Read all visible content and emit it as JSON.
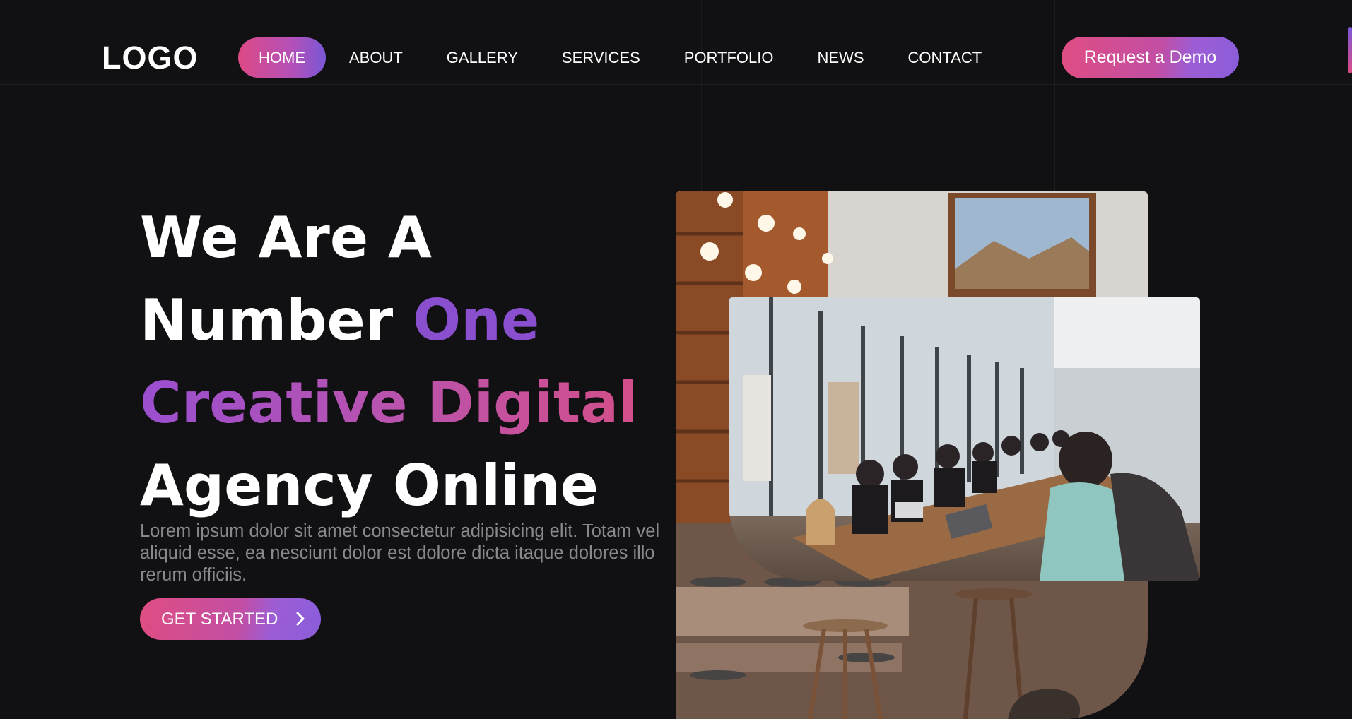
{
  "header": {
    "logo": "LOGO",
    "nav": [
      {
        "label": "HOME",
        "active": true
      },
      {
        "label": "ABOUT",
        "active": false
      },
      {
        "label": "GALLERY",
        "active": false
      },
      {
        "label": "SERVICES",
        "active": false
      },
      {
        "label": "PORTFOLIO",
        "active": false
      },
      {
        "label": "NEWS",
        "active": false
      },
      {
        "label": "CONTACT",
        "active": false
      }
    ],
    "cta_label": "Request a Demo"
  },
  "hero": {
    "line1": "We Are A",
    "line2_a": "Number ",
    "line2_b": "One",
    "line3": "Creative Digital",
    "line4": "Agency Online",
    "description": "Lorem ipsum dolor sit amet consectetur adipisicing elit. Totam vel aliquid esse, ea nesciunt dolor est dolore dicta itaque dolores illo rerum officiis.",
    "cta_label": "GET STARTED",
    "cta_icon": "chevron-right-icon"
  },
  "images": {
    "back": "office-cafe-photo",
    "front": "meeting-room-photo"
  },
  "colors": {
    "background": "#111012",
    "accent_pink": "#dd4a86",
    "accent_purple": "#8a4fcf",
    "text_muted": "#8a888d"
  }
}
